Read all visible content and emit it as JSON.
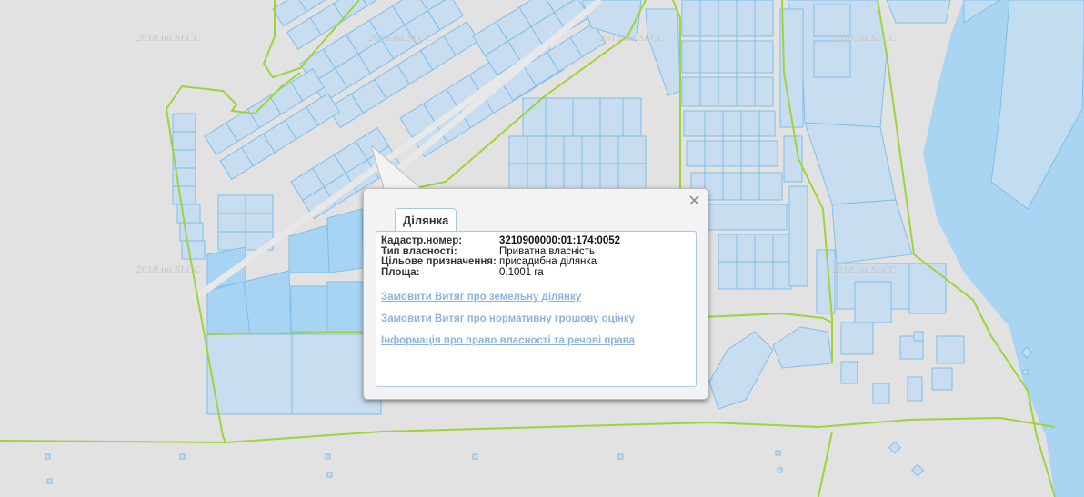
{
  "watermark": "2018.ua.SLCC",
  "popup": {
    "tab_label": "Ділянка",
    "close_glyph": "×",
    "fields": [
      {
        "label": "Кадастр.номер:",
        "value": "3210900000:01:174:0052"
      },
      {
        "label": "Тип власності:",
        "value": "Приватна власність"
      },
      {
        "label": "Цільове призначення:",
        "value": "присадибна ділянка"
      },
      {
        "label": "Площа:",
        "value": "0.1001 га"
      }
    ],
    "links": [
      "Замовити Витяг про земельну ділянку",
      "Замовити Витяг про нормативну грошову оцінку",
      "Інформація про право власності та речові права"
    ]
  },
  "colors": {
    "background": "#e2e2e2",
    "parcel_fill": "#c9ddf0",
    "parcel_stroke": "#7fbfe8",
    "selected_fill": "#a8d4f4",
    "water": "#a9d4f2",
    "boundary": "#9fd33a",
    "link": "#8eb4dc"
  }
}
